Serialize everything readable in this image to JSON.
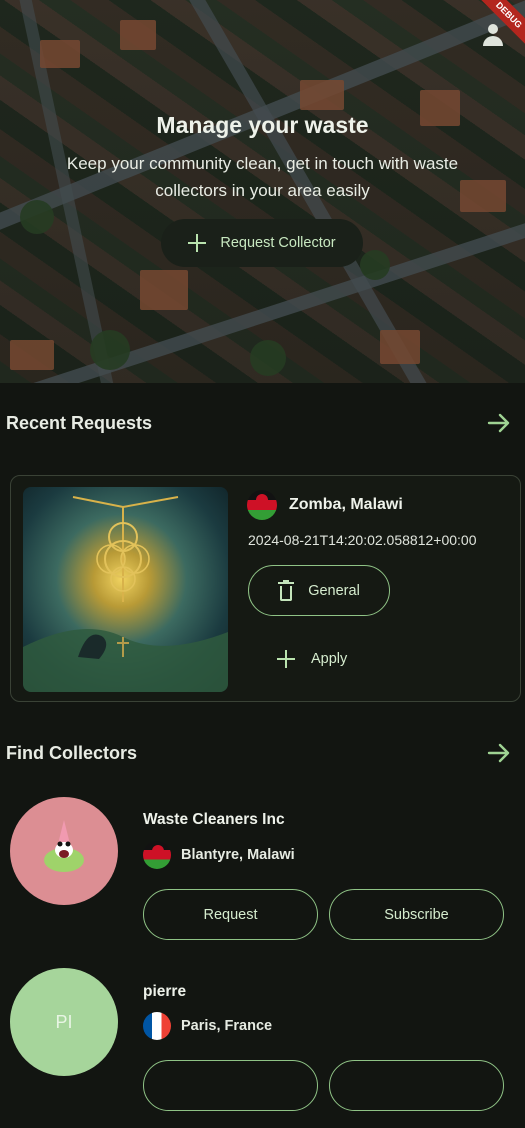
{
  "hero": {
    "title": "Manage your waste",
    "subtitle": "Keep your community clean, get in touch with waste collectors in your area easily",
    "request_button": "Request Collector",
    "debug_banner": "DEBUG"
  },
  "recent": {
    "title": "Recent Requests",
    "card": {
      "location": "Zomba, Malawi",
      "date": "2024-08-21T14:20:02.058812+00:00",
      "category": "General",
      "apply_label": "Apply"
    }
  },
  "collectors": {
    "title": "Find Collectors",
    "items": [
      {
        "name": "Waste Cleaners Inc",
        "location": "Blantyre, Malawi",
        "flag": "malawi",
        "request_label": "Request",
        "subscribe_label": "Subscribe"
      },
      {
        "name": "pierre",
        "initials": "PI",
        "location": "Paris, France",
        "flag": "france"
      }
    ]
  },
  "colors": {
    "background": "#121511",
    "accent": "#8fc386",
    "card_border": "#3a4236"
  }
}
